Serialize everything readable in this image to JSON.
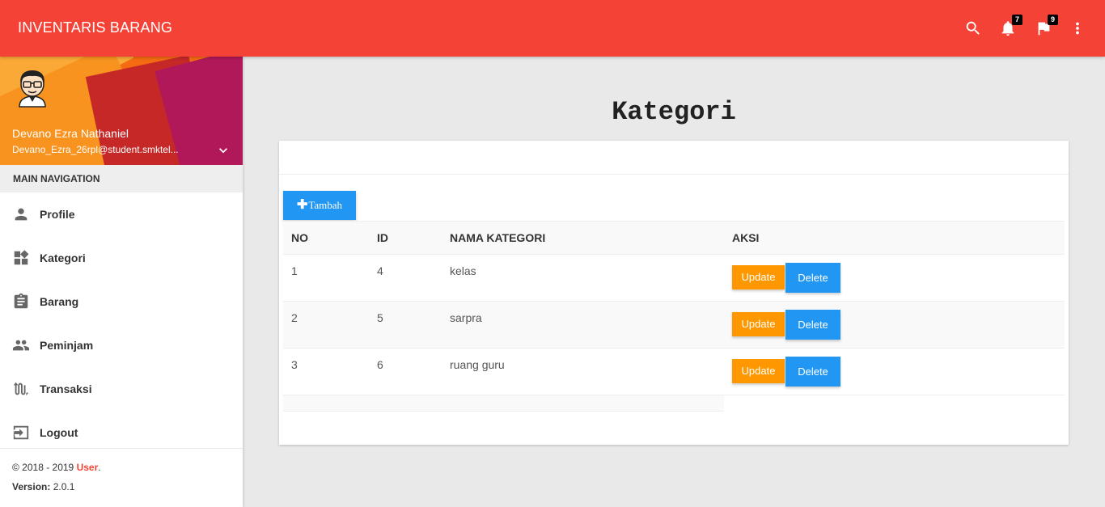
{
  "topbar": {
    "brand": "INVENTARIS BARANG",
    "icons": [
      {
        "name": "search-icon"
      },
      {
        "name": "notifications-icon",
        "badge": "7"
      },
      {
        "name": "flag-icon",
        "badge": "9"
      },
      {
        "name": "more-vert-icon"
      }
    ],
    "color": "#f44336"
  },
  "user": {
    "name": "Devano Ezra Nathaniel",
    "email": "Devano_Ezra_26rpl@student.smktel..."
  },
  "sidebar": {
    "header": "MAIN NAVIGATION",
    "items": [
      {
        "label": "Profile",
        "icon": "person-icon"
      },
      {
        "label": "Kategori",
        "icon": "widgets-icon"
      },
      {
        "label": "Barang",
        "icon": "clipboard-icon"
      },
      {
        "label": "Peminjam",
        "icon": "people-icon"
      },
      {
        "label": "Transaksi",
        "icon": "swap-icon"
      },
      {
        "label": "Logout",
        "icon": "logout-icon"
      }
    ],
    "legal": {
      "copyright": "© 2018 - 2019 ",
      "brand": "User",
      "brand_suffix": ".",
      "version_label": "Version:",
      "version": " 2.0.1"
    }
  },
  "main": {
    "title": "Kategori",
    "add_button": "Tambah",
    "table": {
      "headers": [
        "NO",
        "ID",
        "NAMA KATEGORI",
        "AKSI"
      ],
      "rows": [
        {
          "no": "1",
          "id": "4",
          "nama": "kelas"
        },
        {
          "no": "2",
          "id": "5",
          "nama": "sarpra"
        },
        {
          "no": "3",
          "id": "6",
          "nama": "ruang guru"
        }
      ],
      "update_label": "Update",
      "delete_label": "Delete"
    }
  },
  "colors": {
    "accent": "#f44336",
    "primary": "#2196f3",
    "warning": "#ff9800"
  }
}
